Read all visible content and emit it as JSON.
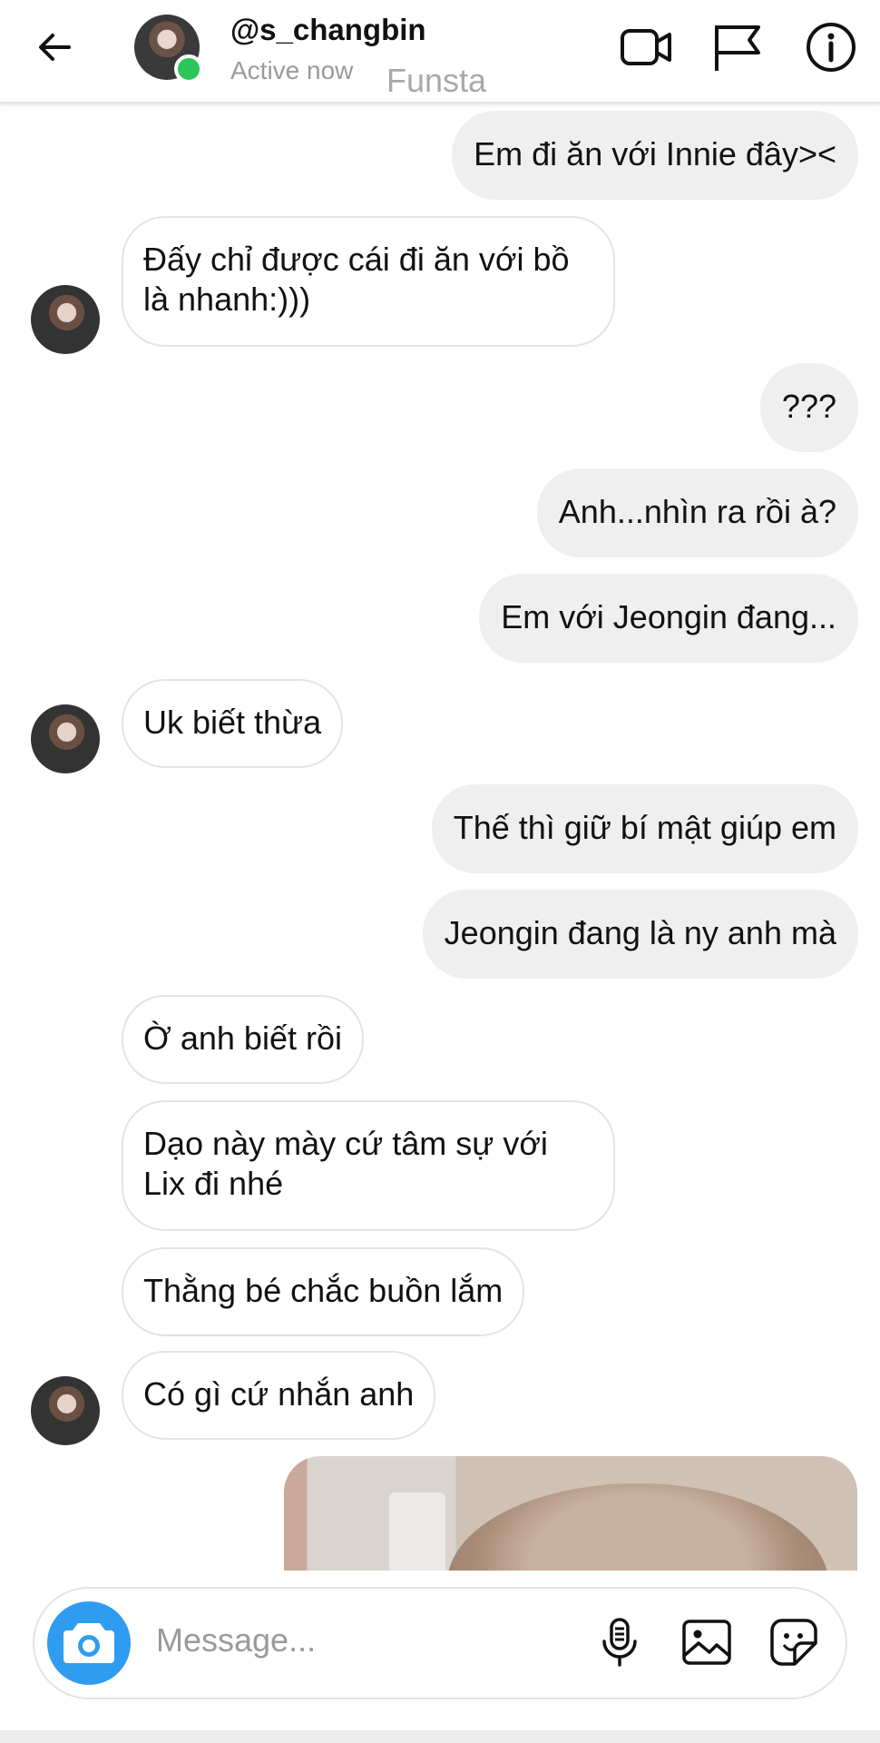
{
  "header": {
    "username": "@s_changbin",
    "status": "Active now",
    "watermark": "Funsta",
    "icons": [
      "back-arrow-icon",
      "video-call-icon",
      "flag-icon",
      "info-icon"
    ]
  },
  "messages": [
    {
      "side": "out",
      "text": "Em đi ăn với Innie đây><"
    },
    {
      "side": "in",
      "lines": [
        "Đấy chỉ được cái đi ăn với bồ",
        "là nhanh:)))"
      ]
    },
    {
      "side": "out",
      "text": "???"
    },
    {
      "side": "out",
      "text": "Anh...nhìn ra rồi à?"
    },
    {
      "side": "out",
      "text": "Em với Jeongin đang..."
    },
    {
      "side": "in",
      "text": "Uk biết thừa"
    },
    {
      "side": "out",
      "text": "Thế thì giữ bí mật giúp em"
    },
    {
      "side": "out",
      "text": "Jeongin đang là ny anh mà"
    },
    {
      "side": "in",
      "text": "Ờ anh biết rồi"
    },
    {
      "side": "in",
      "lines": [
        "Dạo này mày cứ tâm sự với",
        "Lix đi nhé"
      ]
    },
    {
      "side": "in",
      "text": "Thằng bé chắc buồn lắm"
    },
    {
      "side": "in",
      "text": "Có gì cứ nhắn anh"
    }
  ],
  "composer": {
    "placeholder": "Message...",
    "icons": [
      "camera-icon",
      "microphone-icon",
      "gallery-icon",
      "sticker-icon"
    ]
  },
  "colors": {
    "accent": "#2f9cf0",
    "online": "#2ec55a",
    "outgoing_bubble": "#efefef"
  }
}
